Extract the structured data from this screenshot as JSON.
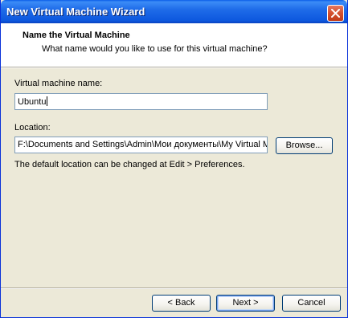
{
  "window": {
    "title": "New Virtual Machine Wizard"
  },
  "header": {
    "title": "Name the Virtual Machine",
    "subtitle": "What name would you like to use for this virtual machine?"
  },
  "form": {
    "vm_name_label": "Virtual machine name:",
    "vm_name_value": "Ubuntu",
    "location_label": "Location:",
    "location_value": "F:\\Documents and Settings\\Admin\\Мои документы\\My Virtual M",
    "browse_label": "Browse...",
    "hint": "The default location can be changed at Edit > Preferences."
  },
  "footer": {
    "back_label": "< Back",
    "next_label": "Next >",
    "cancel_label": "Cancel"
  },
  "colors": {
    "titlebar": "#0d58de",
    "dialog_bg": "#ece9d8",
    "close_button": "#d3502f"
  }
}
